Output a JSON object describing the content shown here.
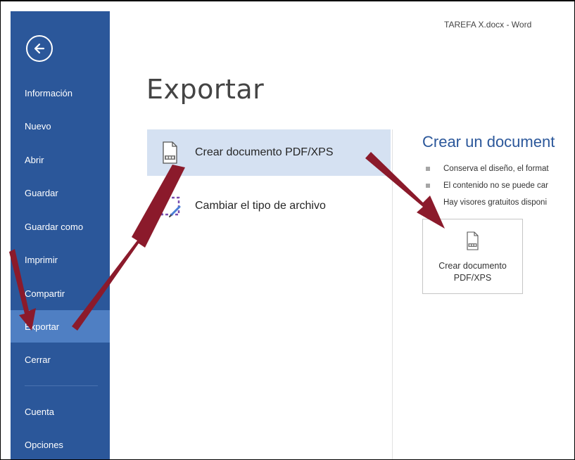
{
  "window": {
    "title": "TAREFA X.docx - Word"
  },
  "sidebar": {
    "items": [
      {
        "label": "Información"
      },
      {
        "label": "Nuevo"
      },
      {
        "label": "Abrir"
      },
      {
        "label": "Guardar"
      },
      {
        "label": "Guardar como"
      },
      {
        "label": "Imprimir"
      },
      {
        "label": "Compartir"
      },
      {
        "label": "Exportar",
        "active": true
      },
      {
        "label": "Cerrar"
      },
      {
        "label": "Cuenta"
      },
      {
        "label": "Opciones"
      }
    ]
  },
  "main": {
    "title": "Exportar",
    "options": [
      {
        "label": "Crear documento PDF/XPS",
        "icon": "pdf-document-icon",
        "selected": true
      },
      {
        "label": "Cambiar el tipo de archivo",
        "icon": "change-file-type-icon",
        "selected": false
      }
    ]
  },
  "detail": {
    "title": "Crear un document",
    "bullets": [
      "Conserva el diseño, el format",
      "El contenido no se puede car",
      "Hay visores gratuitos disponi"
    ],
    "button_line1": "Crear documento",
    "button_line2": "PDF/XPS"
  },
  "annotation_color": "#8b1a2b",
  "colors": {
    "sidebar": "#2b579a",
    "sidebar_active": "#4f7fc3",
    "selection": "#d5e1f2",
    "accent_text": "#2b579a"
  }
}
